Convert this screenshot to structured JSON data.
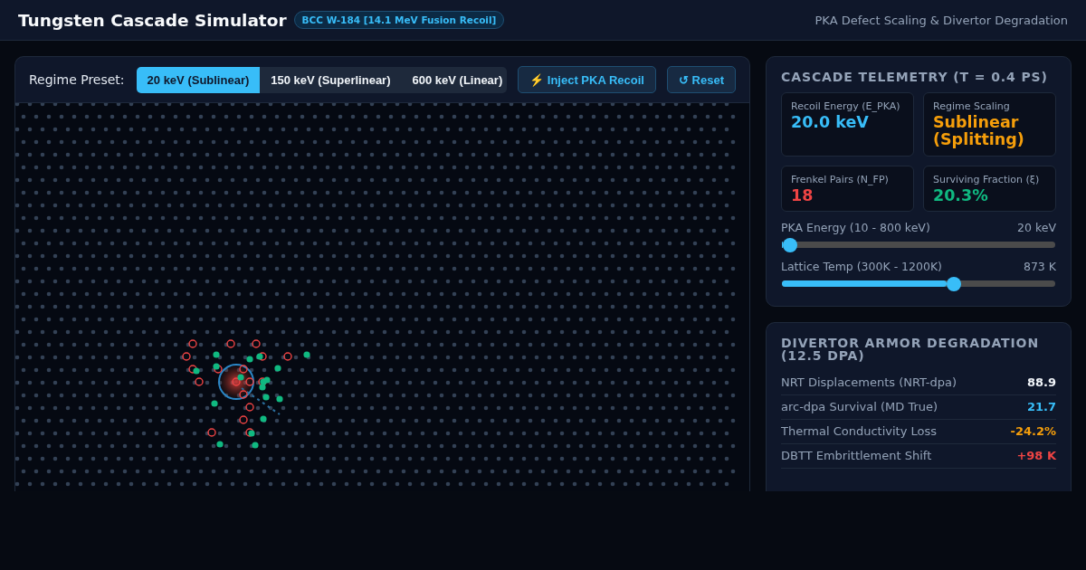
{
  "header": {
    "title": "Tungsten Cascade Simulator",
    "badge": "BCC W-184 [14.1 MeV Fusion Recoil]",
    "subtitle": "PKA Defect Scaling & Divertor Degradation"
  },
  "controls": {
    "preset_label": "Regime Preset:",
    "presets": [
      {
        "label": "20 keV (Sublinear)",
        "selected": true
      },
      {
        "label": "150 keV (Superlinear)",
        "selected": false
      },
      {
        "label": "600 keV (Linear)",
        "selected": false
      }
    ],
    "buttons": [
      {
        "icon": "⚡",
        "label": "Inject PKA Recoil"
      },
      {
        "icon": "↺",
        "label": "Reset"
      }
    ]
  },
  "telemetry": {
    "title": "CASCADE TELEMETRY (T = 0.4 PS)",
    "stats": [
      {
        "label": "Recoil Energy (E_PKA)",
        "value": "20.0 keV",
        "color": "#38bdf8"
      },
      {
        "label": "Regime Scaling",
        "value": "Sublinear (Splitting)",
        "color": "#f59e0b"
      },
      {
        "label": "Frenkel Pairs (N_FP)",
        "value": "18",
        "color": "#ef4444"
      },
      {
        "label": "Surviving Fraction (ξ)",
        "value": "20.3%",
        "color": "#10b981"
      }
    ],
    "sliders": [
      {
        "label": "PKA Energy (10 - 800 keV)",
        "reading": "20 keV",
        "level": 0.03
      },
      {
        "label": "Lattice Temp (300K - 1200K)",
        "reading": "873 K",
        "level": 0.63
      }
    ]
  },
  "degradation": {
    "title": "DIVERTOR ARMOR DEGRADATION (12.5 DPA)",
    "rows": [
      {
        "label": "NRT Displacements (NRT-dpa)",
        "value": "88.9",
        "color": "#f1f5f9"
      },
      {
        "label": "arc-dpa Survival (MD True)",
        "value": "21.7",
        "color": "#38bdf8"
      },
      {
        "label": "Thermal Conductivity Loss",
        "value": "-24.2%",
        "color": "#f59e0b"
      },
      {
        "label": "DBTT Embrittlement Shift",
        "value": "+98 K",
        "color": "#ef4444"
      }
    ]
  }
}
